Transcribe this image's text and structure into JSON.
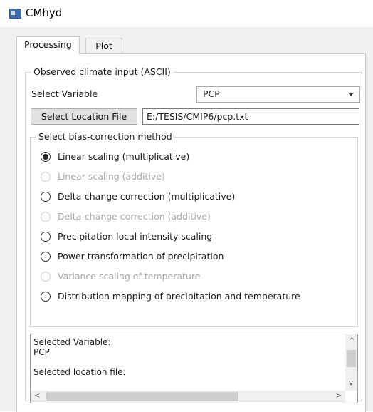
{
  "window": {
    "title": "CMhyd",
    "icon": "app-window-icon"
  },
  "tabs": [
    {
      "label": "Processing",
      "active": true
    },
    {
      "label": "Plot",
      "active": false
    }
  ],
  "observed": {
    "legend": "Observed climate input (ASCII)",
    "select_variable_label": "Select Variable",
    "variable_value": "PCP",
    "select_location_button": "Select Location File",
    "location_path": "E:/TESIS/CMIP6/pcp.txt"
  },
  "bias": {
    "legend": "Select bias-correction method",
    "options": [
      {
        "label": "Linear scaling (multiplicative)",
        "checked": true,
        "enabled": true
      },
      {
        "label": "Linear scaling (additive)",
        "checked": false,
        "enabled": false
      },
      {
        "label": "Delta-change correction (multiplicative)",
        "checked": false,
        "enabled": true
      },
      {
        "label": "Delta-change correction (additive)",
        "checked": false,
        "enabled": false
      },
      {
        "label": "Precipitation local intensity scaling",
        "checked": false,
        "enabled": true
      },
      {
        "label": "Power transformation of precipitation",
        "checked": false,
        "enabled": true
      },
      {
        "label": "Variance scaling of temperature",
        "checked": false,
        "enabled": false
      },
      {
        "label": "Distribution mapping of precipitation and temperature",
        "checked": false,
        "enabled": true
      }
    ]
  },
  "log": {
    "lines": [
      "Selected Variable:",
      "PCP",
      "",
      "Selected location file:"
    ]
  },
  "scroll": {
    "up": "^",
    "down": "v",
    "left": "<",
    "right": ">"
  }
}
